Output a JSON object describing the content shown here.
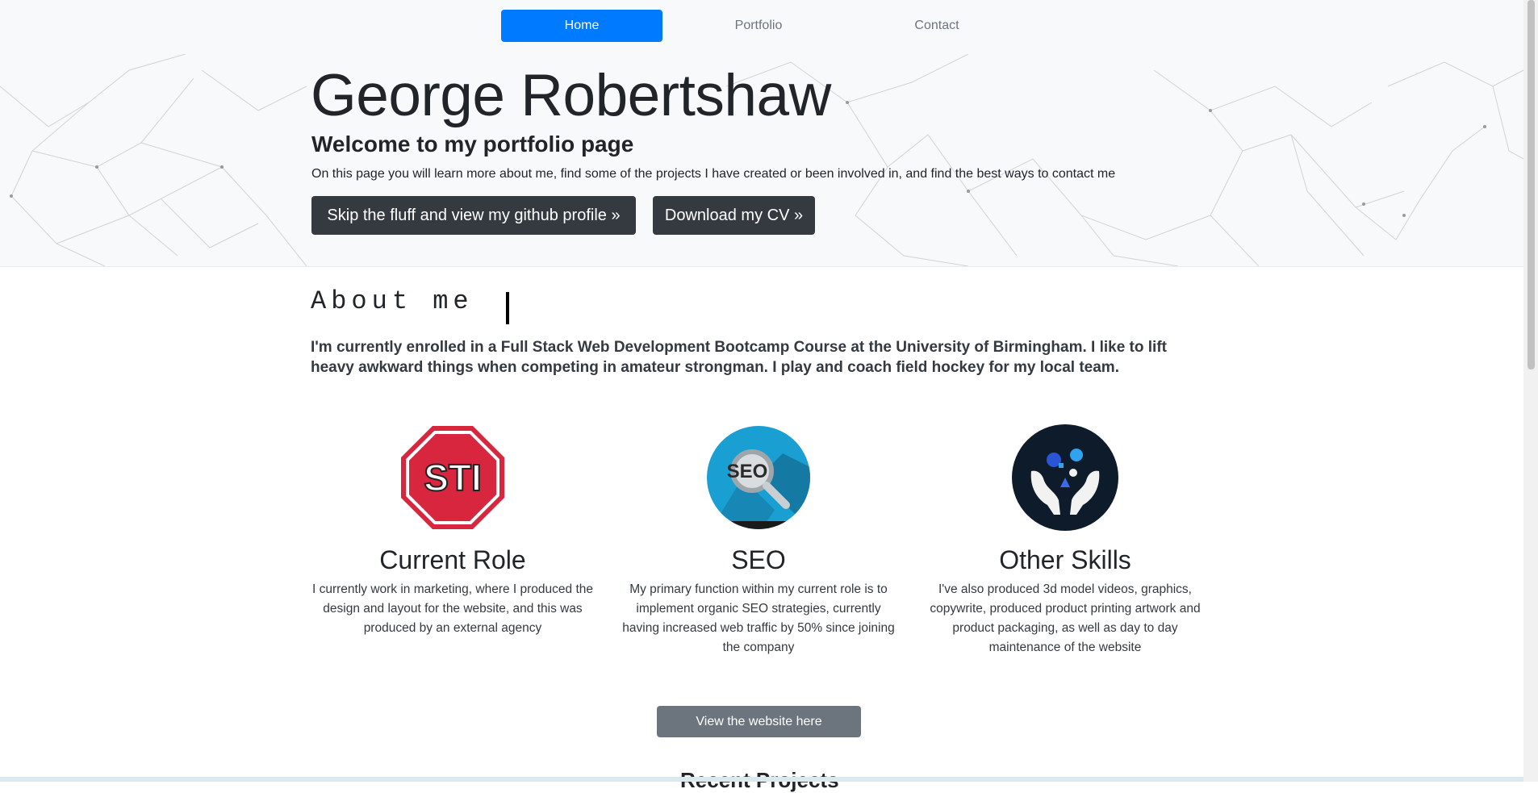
{
  "nav": {
    "items": [
      {
        "label": "Home",
        "active": true
      },
      {
        "label": "Portfolio",
        "active": false
      },
      {
        "label": "Contact",
        "active": false
      }
    ]
  },
  "hero": {
    "title": "George Robertshaw",
    "subtitle": "Welcome to my portfolio page",
    "lead": "On this page you will learn more about me, find some of the projects I have created or been involved in, and find the best ways to contact me",
    "github_button": "Skip the fluff and view my github profile »",
    "cv_button": "Download my CV »"
  },
  "about": {
    "heading": "About me",
    "text": "I'm currently enrolled in a Full Stack Web Development Bootcamp Course at the University of Birmingham. I like to lift heavy awkward things when competing in amateur strongman. I play and coach field hockey for my local team."
  },
  "cards": [
    {
      "icon": "stop-sign-icon",
      "icon_text": "STI",
      "title": "Current Role",
      "text": "I currently work in marketing, where I produced the design and layout for the website, and this was produced by an external agency"
    },
    {
      "icon": "seo-magnifier-icon",
      "icon_text": "SEO",
      "title": "SEO",
      "text": "My primary function within my current role is to implement organic SEO strategies, currently having increased web traffic by 50% since joining the company"
    },
    {
      "icon": "skills-hands-icon",
      "title": "Other Skills",
      "text": "I've also produced 3d model videos, graphics, copywrite, produced product printing artwork and product packaging, as well as day to day maintenance of the website"
    }
  ],
  "website_button": "View the website here",
  "next_section_heading": "Recent Projects",
  "colors": {
    "primary": "#007bff",
    "dark": "#343a40",
    "secondary": "#6c757d",
    "light": "#f8f9fa",
    "sti_red": "#d7263d",
    "seo_blue": "#1a9fd3",
    "navy": "#0d1b2a"
  }
}
